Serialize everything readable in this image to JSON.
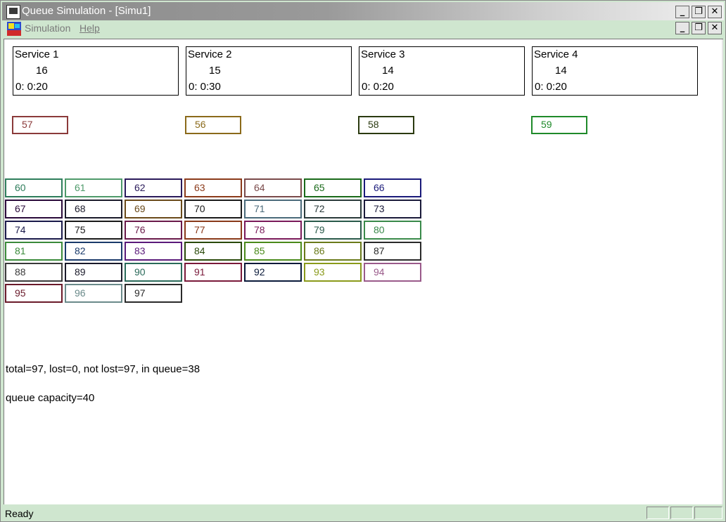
{
  "window": {
    "title": "Queue Simulation - [Simu1]",
    "controls": {
      "minimize": "_",
      "restore": "❐",
      "close": "✕"
    }
  },
  "menubar": {
    "items": [
      "Simulation",
      "Help"
    ],
    "mdi_controls": {
      "minimize": "_",
      "restore": "❐",
      "close": "✕"
    }
  },
  "services": [
    {
      "name": "Service  1",
      "count": "16",
      "time": "0: 0:20",
      "customer": "57",
      "customer_color": "#8b3a3a"
    },
    {
      "name": "Service  2",
      "count": "15",
      "time": "0: 0:30",
      "customer": "56",
      "customer_color": "#8b6a1a"
    },
    {
      "name": "Service  3",
      "count": "14",
      "time": "0: 0:20",
      "customer": "58",
      "customer_color": "#2b3a10"
    },
    {
      "name": "Service  4",
      "count": "14",
      "time": "0: 0:20",
      "customer": "59",
      "customer_color": "#1f8a2a"
    }
  ],
  "queue": [
    {
      "id": "60",
      "color": "#2e7d5b"
    },
    {
      "id": "61",
      "color": "#4e9a6a"
    },
    {
      "id": "62",
      "color": "#2a1a5a"
    },
    {
      "id": "63",
      "color": "#8b3a1a"
    },
    {
      "id": "64",
      "color": "#7a4a4a"
    },
    {
      "id": "65",
      "color": "#1a6a1a"
    },
    {
      "id": "66",
      "color": "#1a1a7a"
    },
    {
      "id": "67",
      "color": "#2a0a3a"
    },
    {
      "id": "68",
      "color": "#1a1a2a"
    },
    {
      "id": "69",
      "color": "#6a4a1a"
    },
    {
      "id": "70",
      "color": "#1a1a1a"
    },
    {
      "id": "71",
      "color": "#4a6a7a"
    },
    {
      "id": "72",
      "color": "#2a3a3a"
    },
    {
      "id": "73",
      "color": "#1a1a3a"
    },
    {
      "id": "74",
      "color": "#1a1a4a"
    },
    {
      "id": "75",
      "color": "#1a1a1a"
    },
    {
      "id": "76",
      "color": "#6a1a4a"
    },
    {
      "id": "77",
      "color": "#8a3a1a"
    },
    {
      "id": "78",
      "color": "#7a1a5a"
    },
    {
      "id": "79",
      "color": "#2a5a4a"
    },
    {
      "id": "80",
      "color": "#3a8a4a"
    },
    {
      "id": "81",
      "color": "#3a8a3a"
    },
    {
      "id": "82",
      "color": "#1a3a6a"
    },
    {
      "id": "83",
      "color": "#5a1a7a"
    },
    {
      "id": "84",
      "color": "#2a4a0a"
    },
    {
      "id": "85",
      "color": "#4a8a1a"
    },
    {
      "id": "86",
      "color": "#6a7a1a"
    },
    {
      "id": "87",
      "color": "#2a2a2a"
    },
    {
      "id": "88",
      "color": "#3a3a3a"
    },
    {
      "id": "89",
      "color": "#1a1a2a"
    },
    {
      "id": "90",
      "color": "#2a6a5a"
    },
    {
      "id": "91",
      "color": "#7a1a3a"
    },
    {
      "id": "92",
      "color": "#0a1a3a"
    },
    {
      "id": "93",
      "color": "#8a9a1a"
    },
    {
      "id": "94",
      "color": "#9a5a8a"
    },
    {
      "id": "95",
      "color": "#6a1a2a"
    },
    {
      "id": "96",
      "color": "#6a8a8a"
    },
    {
      "id": "97",
      "color": "#2a2a2a"
    }
  ],
  "stats": {
    "summary": "total=97, lost=0, not lost=97, in queue=38",
    "capacity": "queue capacity=40"
  },
  "statusbar": {
    "text": "Ready"
  }
}
